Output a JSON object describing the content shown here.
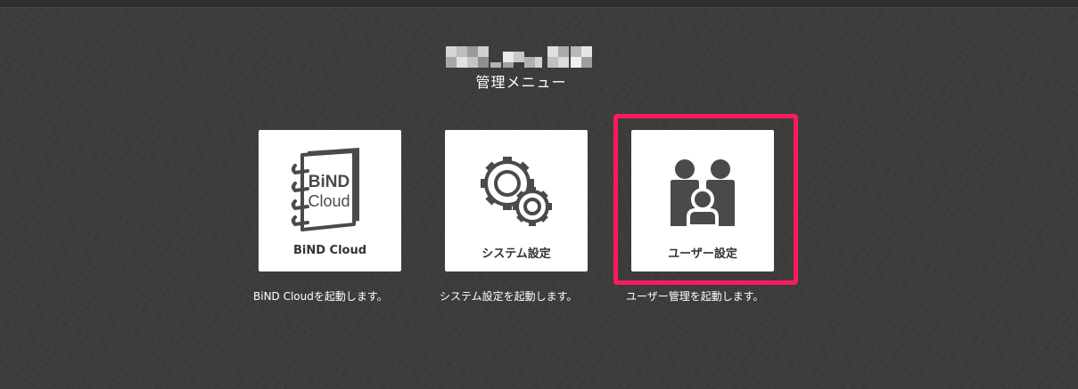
{
  "header": {
    "title": "管理メニュー"
  },
  "cards": [
    {
      "label": "BiND Cloud",
      "description": "BiND Cloudを起動します。",
      "icon": "bind-cloud-logo-icon",
      "logo_text_1": "BiND",
      "logo_text_2": "Cloud"
    },
    {
      "label": "システム設定",
      "description": "システム設定を起動します。",
      "icon": "gears-icon"
    },
    {
      "label": "ユーザー設定",
      "description": "ユーザー管理を起動します。",
      "icon": "users-icon"
    }
  ],
  "colors": {
    "background": "#3c3c3c",
    "card": "#ffffff",
    "icon": "#4a4a4a",
    "highlight": "#ff1a5e"
  }
}
